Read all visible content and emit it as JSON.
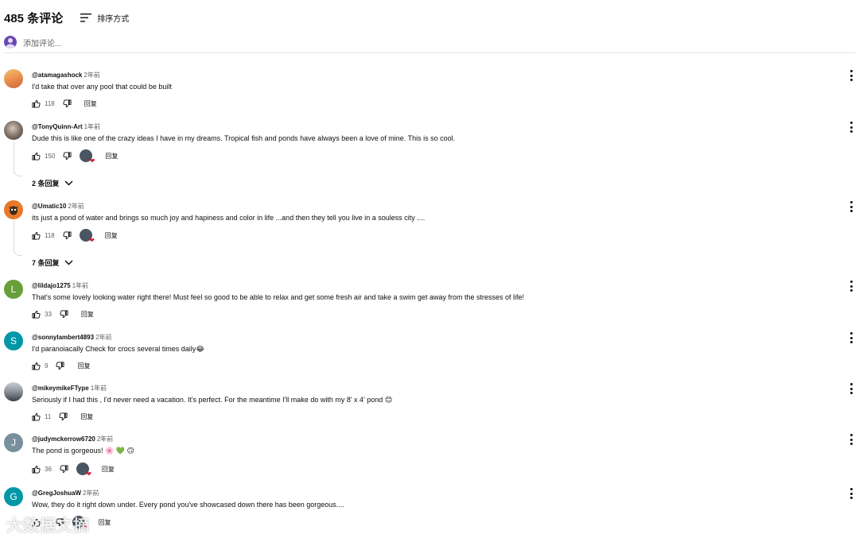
{
  "header": {
    "count": "485 条评论",
    "sort_label": "排序方式"
  },
  "add_comment": {
    "placeholder": "添加评论..."
  },
  "reply_label": "回复",
  "comments": [
    {
      "author": "@atamagashock",
      "time": "2年前",
      "text": "I'd take that over any pool that could be built",
      "likes": "118",
      "avatar_letter": "",
      "avatar_color": "#e88a4a",
      "hearted": false,
      "replies": ""
    },
    {
      "author": "@TonyQuinn-Art",
      "time": "1年前",
      "text": "Dude this is like one of the crazy ideas I have in my dreams. Tropical fish and ponds have always been a love of mine. This is so cool.",
      "likes": "150",
      "avatar_letter": "",
      "avatar_color": "#6b5f58",
      "hearted": true,
      "replies": "2 条回复"
    },
    {
      "author": "@Umatic10",
      "time": "2年前",
      "text": "its just a pond of water and brings so much joy and hapiness and color in life ...and then they tell you live in a souless city ....",
      "likes": "118",
      "avatar_letter": "",
      "avatar_color": "#e8782a",
      "hearted": true,
      "replies": "7 条回复"
    },
    {
      "author": "@lildajo1275",
      "time": "1年前",
      "text": "That's some lovely looking water right there! Must feel so good to be able to relax and get some fresh air and take a swim get away from the stresses of life!",
      "likes": "33",
      "avatar_letter": "L",
      "avatar_color": "#689f38",
      "hearted": false,
      "replies": ""
    },
    {
      "author": "@sonnylambert4893",
      "time": "2年前",
      "text": "I'd paranoiacally Check for crocs several times daily",
      "emoji": "😂",
      "likes": "9",
      "avatar_letter": "S",
      "avatar_color": "#0097a7",
      "hearted": false,
      "replies": ""
    },
    {
      "author": "@mikeymikeFType",
      "time": "1年前",
      "text": "Seriously if I had this , I'd never need a vacation. It's perfect. For the meantime I'll make do with my 8' x 4' pond",
      "emoji": "😊",
      "likes": "11",
      "avatar_letter": "",
      "avatar_color": "#5a5f66",
      "hearted": false,
      "replies": ""
    },
    {
      "author": "@judymckerrow6720",
      "time": "2年前",
      "text": "The pond is gorgeous!",
      "emoji": "🌸 💚 🙃",
      "likes": "36",
      "avatar_letter": "J",
      "avatar_color": "#78909c",
      "hearted": true,
      "replies": ""
    },
    {
      "author": "@GregJoshuaW",
      "time": "2年前",
      "text": "Wow, they do it right down under. Every pond you've showcased down there has been gorgeous....",
      "likes": "7",
      "avatar_letter": "G",
      "avatar_color": "#0097a7",
      "hearted": true,
      "replies": ""
    }
  ],
  "watermark": "大数据文摘"
}
